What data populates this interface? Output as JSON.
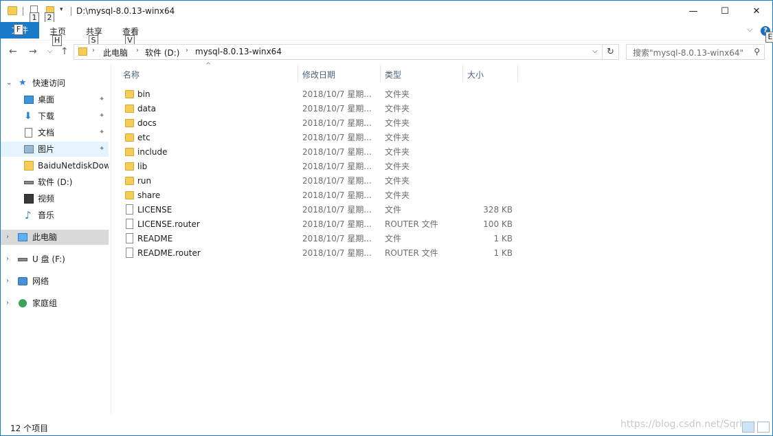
{
  "window": {
    "title": "D:\\mysql-8.0.13-winx64",
    "minimize_glyph": "—",
    "maximize_glyph": "☐",
    "close_glyph": "✕"
  },
  "quick_access_toolbar": {
    "keytip_1": "1",
    "keytip_2": "2",
    "dropdown_glyph": "▾"
  },
  "ribbon": {
    "file_tab": "文件",
    "file_keytip": "F",
    "tabs": [
      {
        "label": "主页",
        "keytip": "H"
      },
      {
        "label": "共享",
        "keytip": "S"
      },
      {
        "label": "查看",
        "keytip": "V"
      }
    ],
    "expand_glyph": "⌵",
    "help_glyph": "?",
    "help_keytip": "E"
  },
  "navigation": {
    "back_glyph": "←",
    "forward_glyph": "→",
    "recent_glyph": "⌵",
    "up_glyph": "↑",
    "breadcrumbs": [
      "此电脑",
      "软件 (D:)",
      "mysql-8.0.13-winx64"
    ],
    "crumb_sep": "›",
    "addr_drop_glyph": "⌵",
    "refresh_glyph": "↻",
    "search_placeholder": "搜索\"mysql-8.0.13-winx64\"",
    "search_glyph": "⚲"
  },
  "sidebar": {
    "quick_access": "快速访问",
    "items": [
      {
        "label": "桌面",
        "pinned": true
      },
      {
        "label": "下载",
        "pinned": true
      },
      {
        "label": "文档",
        "pinned": true
      },
      {
        "label": "图片",
        "pinned": true
      },
      {
        "label": "BaiduNetdiskDow",
        "pinned": false
      },
      {
        "label": "软件 (D:)",
        "pinned": false
      },
      {
        "label": "视频",
        "pinned": false
      },
      {
        "label": "音乐",
        "pinned": false
      }
    ],
    "this_pc": "此电脑",
    "usb": "U 盘 (F:)",
    "network": "网络",
    "homegroup": "家庭组",
    "pin_glyph": "📌",
    "expand_glyph": "›",
    "expanded_glyph": "⌄"
  },
  "columns": {
    "name": "名称",
    "date": "修改日期",
    "type": "类型",
    "size": "大小",
    "sort_glyph": "^"
  },
  "files": [
    {
      "name": "bin",
      "date": "2018/10/7 星期...",
      "type": "文件夹",
      "size": "",
      "kind": "folder"
    },
    {
      "name": "data",
      "date": "2018/10/7 星期...",
      "type": "文件夹",
      "size": "",
      "kind": "folder"
    },
    {
      "name": "docs",
      "date": "2018/10/7 星期...",
      "type": "文件夹",
      "size": "",
      "kind": "folder"
    },
    {
      "name": "etc",
      "date": "2018/10/7 星期...",
      "type": "文件夹",
      "size": "",
      "kind": "folder"
    },
    {
      "name": "include",
      "date": "2018/10/7 星期...",
      "type": "文件夹",
      "size": "",
      "kind": "folder"
    },
    {
      "name": "lib",
      "date": "2018/10/7 星期...",
      "type": "文件夹",
      "size": "",
      "kind": "folder"
    },
    {
      "name": "run",
      "date": "2018/10/7 星期...",
      "type": "文件夹",
      "size": "",
      "kind": "folder"
    },
    {
      "name": "share",
      "date": "2018/10/7 星期...",
      "type": "文件夹",
      "size": "",
      "kind": "folder"
    },
    {
      "name": "LICENSE",
      "date": "2018/10/7 星期...",
      "type": "文件",
      "size": "328 KB",
      "kind": "file"
    },
    {
      "name": "LICENSE.router",
      "date": "2018/10/7 星期...",
      "type": "ROUTER 文件",
      "size": "100 KB",
      "kind": "file"
    },
    {
      "name": "README",
      "date": "2018/10/7 星期...",
      "type": "文件",
      "size": "1 KB",
      "kind": "file"
    },
    {
      "name": "README.router",
      "date": "2018/10/7 星期...",
      "type": "ROUTER 文件",
      "size": "1 KB",
      "kind": "file"
    }
  ],
  "status": {
    "item_count": "12 个项目",
    "watermark": "https://blog.csdn.net/Sqrl..."
  },
  "colors": {
    "accent": "#1979ca",
    "folder": "#f5cc55",
    "selection": "#cce8ff"
  }
}
